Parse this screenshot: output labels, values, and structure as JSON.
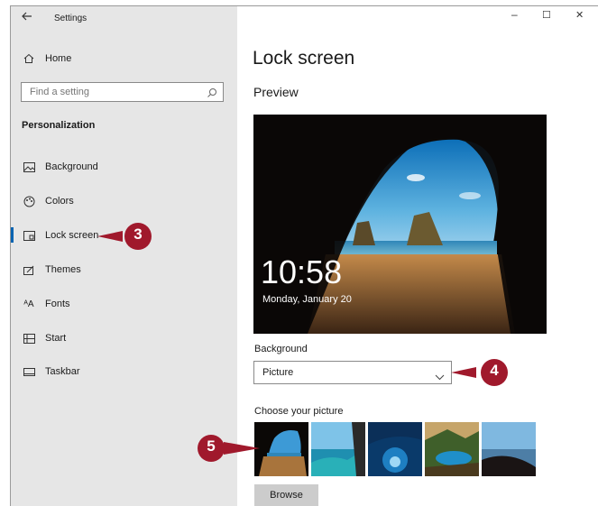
{
  "titlebar": {
    "back_icon": "back-arrow-icon",
    "app_title": "Settings",
    "minimize": "–",
    "maximize": "☐",
    "close": "✕"
  },
  "sidebar": {
    "home_label": "Home",
    "search_placeholder": "Find a setting",
    "section_title": "Personalization",
    "items": [
      {
        "label": "Background",
        "icon": "background-icon",
        "selected": false
      },
      {
        "label": "Colors",
        "icon": "colors-icon",
        "selected": false
      },
      {
        "label": "Lock screen",
        "icon": "lock-screen-icon",
        "selected": true
      },
      {
        "label": "Themes",
        "icon": "themes-icon",
        "selected": false
      },
      {
        "label": "Fonts",
        "icon": "fonts-icon",
        "selected": false
      },
      {
        "label": "Start",
        "icon": "start-icon",
        "selected": false
      },
      {
        "label": "Taskbar",
        "icon": "taskbar-icon",
        "selected": false
      }
    ],
    "selected_indicator_color": "#0063b1"
  },
  "main": {
    "page_title": "Lock screen",
    "preview_heading": "Preview",
    "preview": {
      "time": "10:58",
      "date": "Monday, January 20"
    },
    "background_label": "Background",
    "background_value": "Picture",
    "choose_label": "Choose your picture",
    "browse_label": "Browse"
  },
  "callouts": {
    "c3": "3",
    "c4": "4",
    "c5": "5",
    "color": "#a0192c"
  }
}
